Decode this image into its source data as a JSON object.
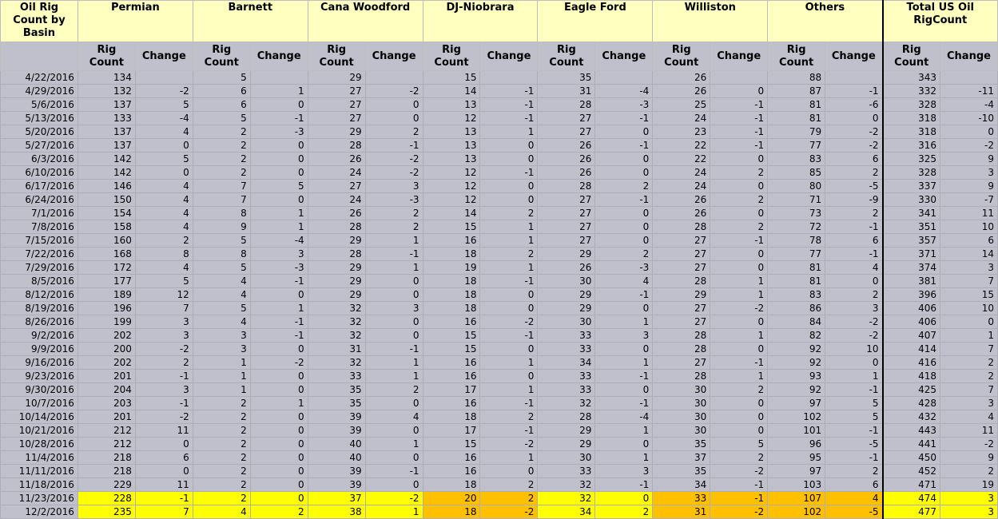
{
  "header": {
    "corner_label": "Oil Rig Count by Basin",
    "basins": [
      "Permian",
      "Barnett",
      "Cana Woodford",
      "DJ-Niobrara",
      "Eagle Ford",
      "Williston",
      "Others",
      "Total US Oil RigCount"
    ],
    "rig_label": "Rig Count",
    "change_label": "Change"
  },
  "highlight_colors": {
    "yellow": "#ffff00",
    "orange": "#ffc000"
  },
  "rows": [
    {
      "date": "4/22/2016",
      "v": [
        "134",
        "",
        "5",
        "",
        "29",
        "",
        "15",
        "",
        "35",
        "",
        "26",
        "",
        "88",
        "",
        "343",
        ""
      ]
    },
    {
      "date": "4/29/2016",
      "v": [
        "132",
        "-2",
        "6",
        "1",
        "27",
        "-2",
        "14",
        "-1",
        "31",
        "-4",
        "26",
        "0",
        "87",
        "-1",
        "332",
        "-11"
      ]
    },
    {
      "date": "5/6/2016",
      "v": [
        "137",
        "5",
        "6",
        "0",
        "27",
        "0",
        "13",
        "-1",
        "28",
        "-3",
        "25",
        "-1",
        "81",
        "-6",
        "328",
        "-4"
      ]
    },
    {
      "date": "5/13/2016",
      "v": [
        "133",
        "-4",
        "5",
        "-1",
        "27",
        "0",
        "12",
        "-1",
        "27",
        "-1",
        "24",
        "-1",
        "81",
        "0",
        "318",
        "-10"
      ]
    },
    {
      "date": "5/20/2016",
      "v": [
        "137",
        "4",
        "2",
        "-3",
        "29",
        "2",
        "13",
        "1",
        "27",
        "0",
        "23",
        "-1",
        "79",
        "-2",
        "318",
        "0"
      ]
    },
    {
      "date": "5/27/2016",
      "v": [
        "137",
        "0",
        "2",
        "0",
        "28",
        "-1",
        "13",
        "0",
        "26",
        "-1",
        "22",
        "-1",
        "77",
        "-2",
        "316",
        "-2"
      ]
    },
    {
      "date": "6/3/2016",
      "v": [
        "142",
        "5",
        "2",
        "0",
        "26",
        "-2",
        "13",
        "0",
        "26",
        "0",
        "22",
        "0",
        "83",
        "6",
        "325",
        "9"
      ]
    },
    {
      "date": "6/10/2016",
      "v": [
        "142",
        "0",
        "2",
        "0",
        "24",
        "-2",
        "12",
        "-1",
        "26",
        "0",
        "24",
        "2",
        "85",
        "2",
        "328",
        "3"
      ]
    },
    {
      "date": "6/17/2016",
      "v": [
        "146",
        "4",
        "7",
        "5",
        "27",
        "3",
        "12",
        "0",
        "28",
        "2",
        "24",
        "0",
        "80",
        "-5",
        "337",
        "9"
      ]
    },
    {
      "date": "6/24/2016",
      "v": [
        "150",
        "4",
        "7",
        "0",
        "24",
        "-3",
        "12",
        "0",
        "27",
        "-1",
        "26",
        "2",
        "71",
        "-9",
        "330",
        "-7"
      ]
    },
    {
      "date": "7/1/2016",
      "v": [
        "154",
        "4",
        "8",
        "1",
        "26",
        "2",
        "14",
        "2",
        "27",
        "0",
        "26",
        "0",
        "73",
        "2",
        "341",
        "11"
      ]
    },
    {
      "date": "7/8/2016",
      "v": [
        "158",
        "4",
        "9",
        "1",
        "28",
        "2",
        "15",
        "1",
        "27",
        "0",
        "28",
        "2",
        "72",
        "-1",
        "351",
        "10"
      ]
    },
    {
      "date": "7/15/2016",
      "v": [
        "160",
        "2",
        "5",
        "-4",
        "29",
        "1",
        "16",
        "1",
        "27",
        "0",
        "27",
        "-1",
        "78",
        "6",
        "357",
        "6"
      ]
    },
    {
      "date": "7/22/2016",
      "v": [
        "168",
        "8",
        "8",
        "3",
        "28",
        "-1",
        "18",
        "2",
        "29",
        "2",
        "27",
        "0",
        "77",
        "-1",
        "371",
        "14"
      ]
    },
    {
      "date": "7/29/2016",
      "v": [
        "172",
        "4",
        "5",
        "-3",
        "29",
        "1",
        "19",
        "1",
        "26",
        "-3",
        "27",
        "0",
        "81",
        "4",
        "374",
        "3"
      ]
    },
    {
      "date": "8/5/2016",
      "v": [
        "177",
        "5",
        "4",
        "-1",
        "29",
        "0",
        "18",
        "-1",
        "30",
        "4",
        "28",
        "1",
        "81",
        "0",
        "381",
        "7"
      ]
    },
    {
      "date": "8/12/2016",
      "v": [
        "189",
        "12",
        "4",
        "0",
        "29",
        "0",
        "18",
        "0",
        "29",
        "-1",
        "29",
        "1",
        "83",
        "2",
        "396",
        "15"
      ]
    },
    {
      "date": "8/19/2016",
      "v": [
        "196",
        "7",
        "5",
        "1",
        "32",
        "3",
        "18",
        "0",
        "29",
        "0",
        "27",
        "-2",
        "86",
        "3",
        "406",
        "10"
      ]
    },
    {
      "date": "8/26/2016",
      "v": [
        "199",
        "3",
        "4",
        "-1",
        "32",
        "0",
        "16",
        "-2",
        "30",
        "1",
        "27",
        "0",
        "84",
        "-2",
        "406",
        "0"
      ]
    },
    {
      "date": "9/2/2016",
      "v": [
        "202",
        "3",
        "3",
        "-1",
        "32",
        "0",
        "15",
        "-1",
        "33",
        "3",
        "28",
        "1",
        "82",
        "-2",
        "407",
        "1"
      ]
    },
    {
      "date": "9/9/2016",
      "v": [
        "200",
        "-2",
        "3",
        "0",
        "31",
        "-1",
        "15",
        "0",
        "33",
        "0",
        "28",
        "0",
        "92",
        "10",
        "414",
        "7"
      ]
    },
    {
      "date": "9/16/2016",
      "v": [
        "202",
        "2",
        "1",
        "-2",
        "32",
        "1",
        "16",
        "1",
        "34",
        "1",
        "27",
        "-1",
        "92",
        "0",
        "416",
        "2"
      ]
    },
    {
      "date": "9/23/2016",
      "v": [
        "201",
        "-1",
        "1",
        "0",
        "33",
        "1",
        "16",
        "0",
        "33",
        "-1",
        "28",
        "1",
        "93",
        "1",
        "418",
        "2"
      ]
    },
    {
      "date": "9/30/2016",
      "v": [
        "204",
        "3",
        "1",
        "0",
        "35",
        "2",
        "17",
        "1",
        "33",
        "0",
        "30",
        "2",
        "92",
        "-1",
        "425",
        "7"
      ]
    },
    {
      "date": "10/7/2016",
      "v": [
        "203",
        "-1",
        "2",
        "1",
        "35",
        "0",
        "16",
        "-1",
        "32",
        "-1",
        "30",
        "0",
        "97",
        "5",
        "428",
        "3"
      ]
    },
    {
      "date": "10/14/2016",
      "v": [
        "201",
        "-2",
        "2",
        "0",
        "39",
        "4",
        "18",
        "2",
        "28",
        "-4",
        "30",
        "0",
        "102",
        "5",
        "432",
        "4"
      ]
    },
    {
      "date": "10/21/2016",
      "v": [
        "212",
        "11",
        "2",
        "0",
        "39",
        "0",
        "17",
        "-1",
        "29",
        "1",
        "30",
        "0",
        "101",
        "-1",
        "443",
        "11"
      ]
    },
    {
      "date": "10/28/2016",
      "v": [
        "212",
        "0",
        "2",
        "0",
        "40",
        "1",
        "15",
        "-2",
        "29",
        "0",
        "35",
        "5",
        "96",
        "-5",
        "441",
        "-2"
      ]
    },
    {
      "date": "11/4/2016",
      "v": [
        "218",
        "6",
        "2",
        "0",
        "40",
        "0",
        "16",
        "1",
        "30",
        "1",
        "37",
        "2",
        "95",
        "-1",
        "450",
        "9"
      ]
    },
    {
      "date": "11/11/2016",
      "v": [
        "218",
        "0",
        "2",
        "0",
        "39",
        "-1",
        "16",
        "0",
        "33",
        "3",
        "35",
        "-2",
        "97",
        "2",
        "452",
        "2"
      ]
    },
    {
      "date": "11/18/2016",
      "v": [
        "229",
        "11",
        "2",
        "0",
        "39",
        "0",
        "18",
        "2",
        "32",
        "-1",
        "34",
        "-1",
        "103",
        "6",
        "471",
        "19"
      ]
    },
    {
      "date": "11/23/2016",
      "v": [
        "228",
        "-1",
        "2",
        "0",
        "37",
        "-2",
        "20",
        "2",
        "32",
        "0",
        "33",
        "-1",
        "107",
        "4",
        "474",
        "3"
      ],
      "hl": [
        "y",
        "y",
        "y",
        "y",
        "y",
        "y",
        "o",
        "o",
        "y",
        "y",
        "o",
        "o",
        "o",
        "o",
        "y",
        "y"
      ]
    },
    {
      "date": "12/2/2016",
      "v": [
        "235",
        "7",
        "4",
        "2",
        "38",
        "1",
        "18",
        "-2",
        "34",
        "2",
        "31",
        "-2",
        "102",
        "-5",
        "477",
        "3"
      ],
      "hl": [
        "y",
        "y",
        "y",
        "y",
        "y",
        "y",
        "o",
        "o",
        "y",
        "y",
        "o",
        "o",
        "o",
        "o",
        "y",
        "y"
      ]
    }
  ]
}
